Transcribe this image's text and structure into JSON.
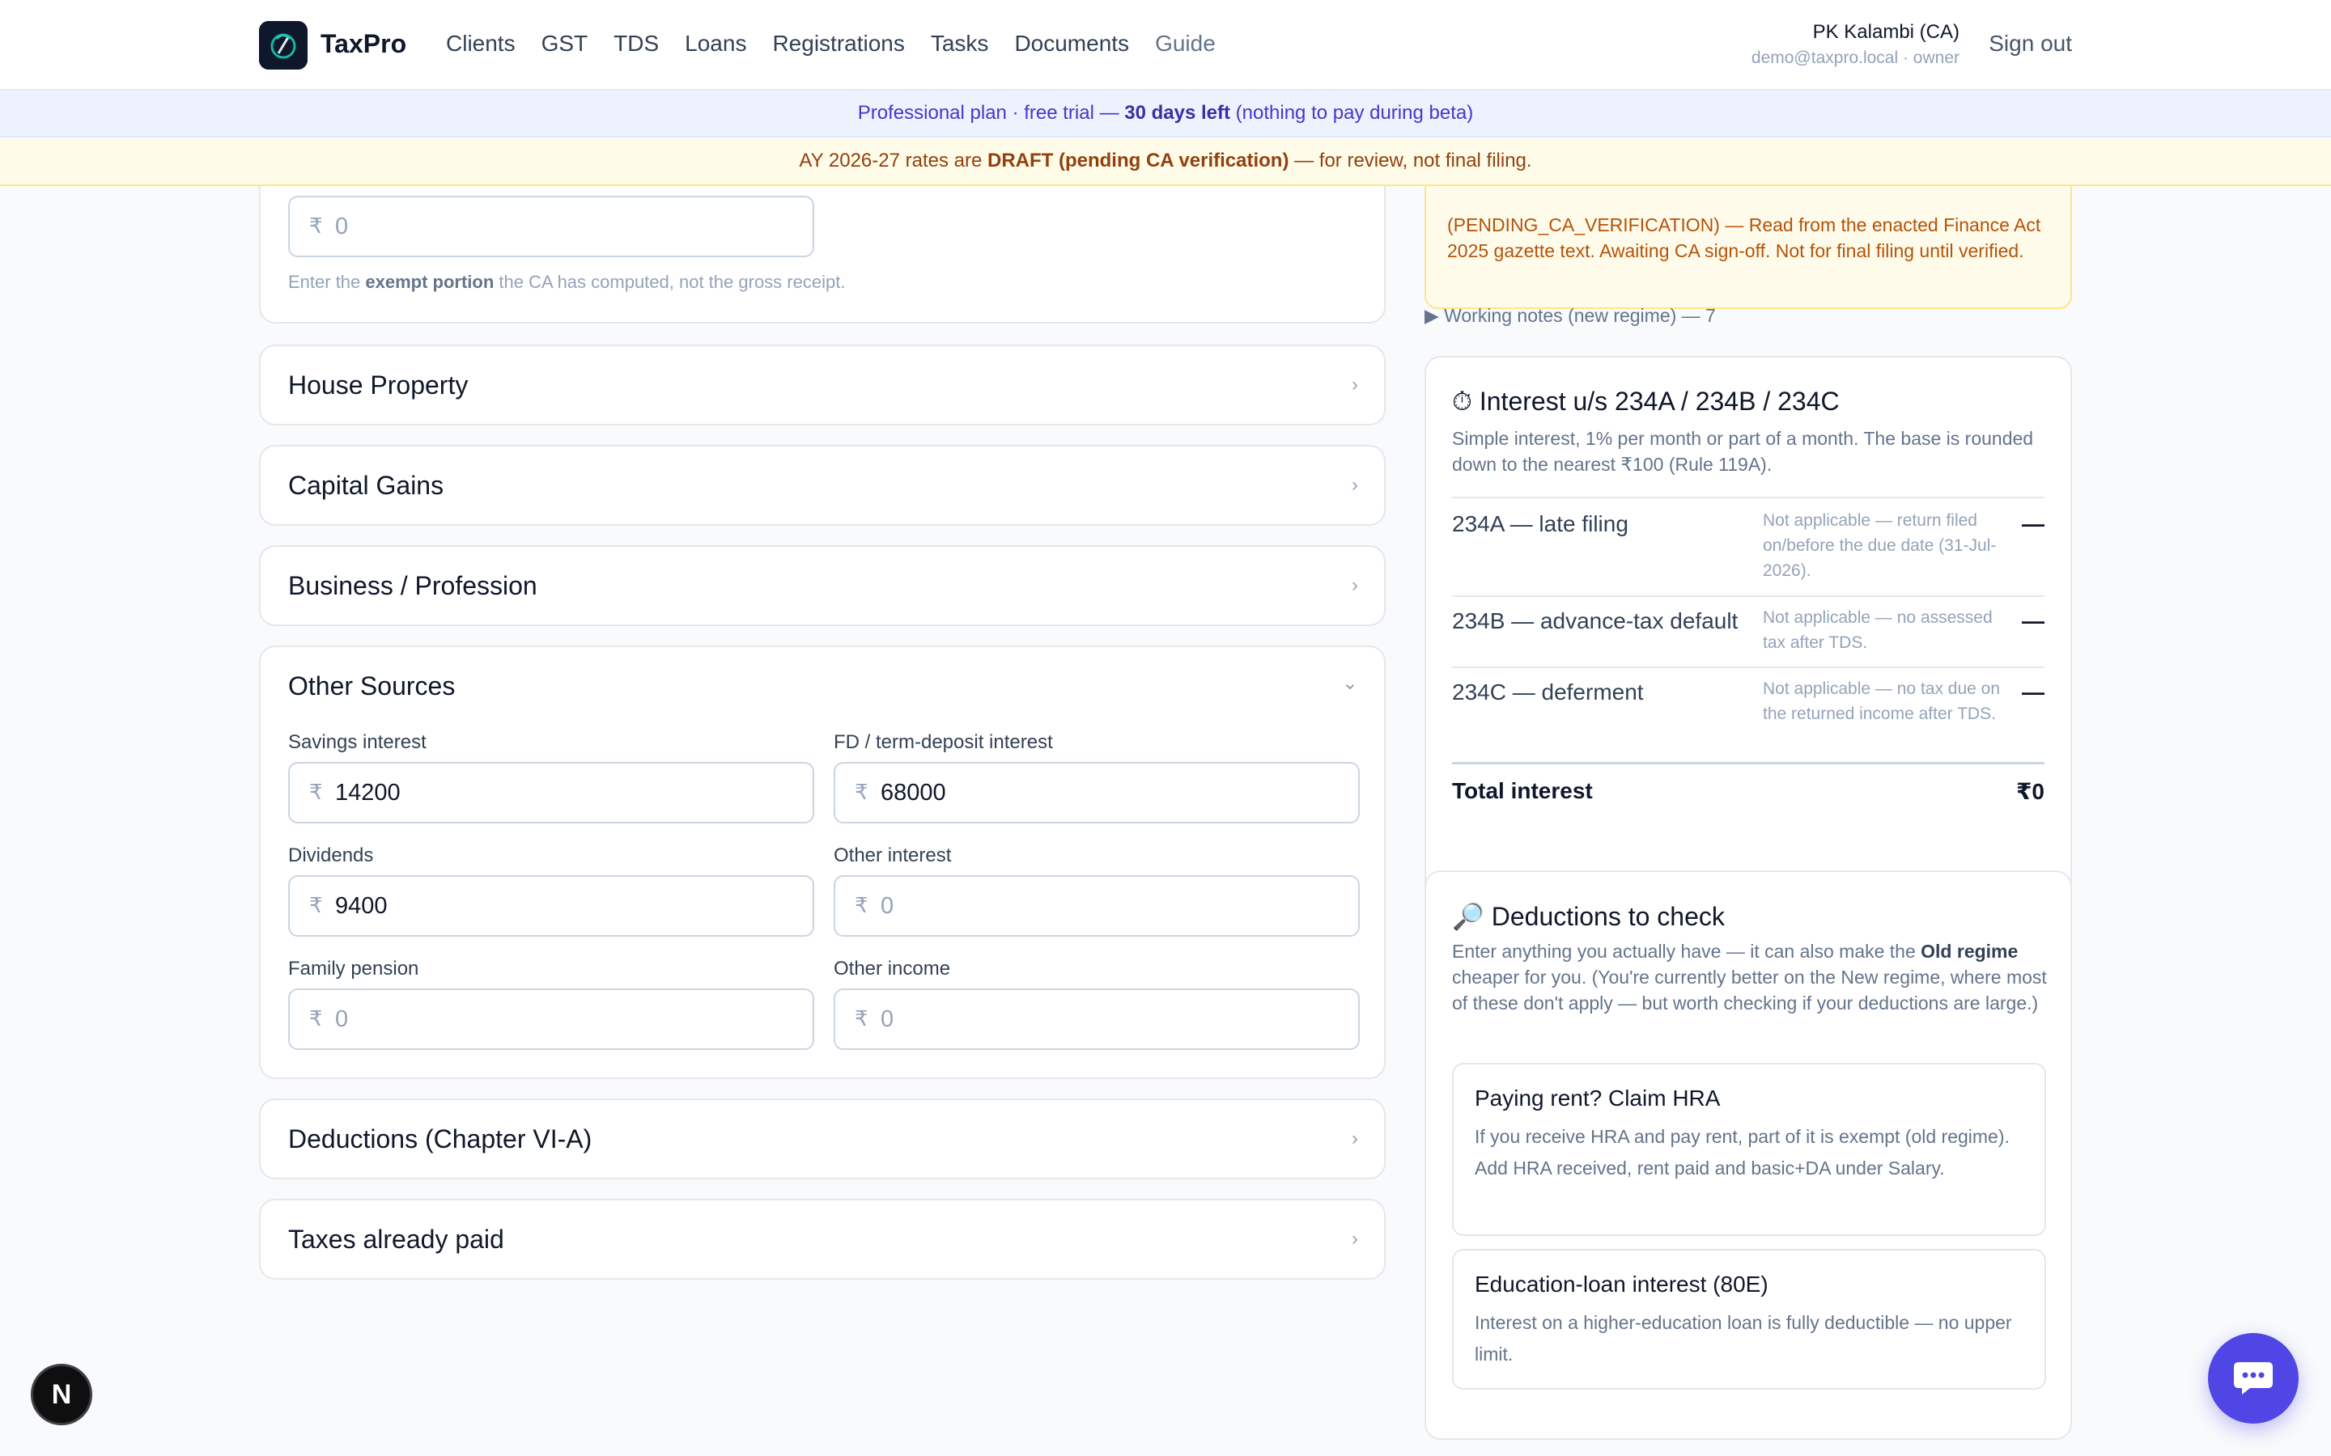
{
  "nav": {
    "brand": "TaxPro",
    "links": [
      "Clients",
      "GST",
      "TDS",
      "Loans",
      "Registrations",
      "Tasks",
      "Documents",
      "Guide"
    ],
    "user_name": "PK Kalambi (CA)",
    "user_email": "demo@taxpro.local · owner",
    "signout": "Sign out"
  },
  "banner_plan": {
    "prefix": "Professional plan · free trial — ",
    "highlight": "30 days left",
    "suffix": " (nothing to pay during beta)"
  },
  "banner_draft": {
    "prefix": "AY 2026-27 rates are ",
    "highlight": "DRAFT (pending CA verification)",
    "suffix": " — for review, not final filing."
  },
  "exempt_field": {
    "value": "0",
    "hint_prefix": "Enter the ",
    "hint_bold": "exempt portion",
    "hint_suffix": " the CA has computed, not the gross receipt."
  },
  "sections": {
    "house_property": "House Property",
    "capital_gains": "Capital Gains",
    "business": "Business / Profession",
    "other_sources": "Other Sources",
    "deductions": "Deductions (Chapter VI-A)",
    "taxes_paid": "Taxes already paid"
  },
  "other_sources": {
    "savings_label": "Savings interest",
    "savings_value": "14200",
    "fd_label": "FD / term-deposit interest",
    "fd_value": "68000",
    "dividends_label": "Dividends",
    "dividends_value": "9400",
    "other_interest_label": "Other interest",
    "other_interest_value": "0",
    "family_pension_label": "Family pension",
    "family_pension_value": "0",
    "other_income_label": "Other income",
    "other_income_value": "0"
  },
  "currency_symbol": "₹",
  "notice": {
    "text": "(PENDING_CA_VERIFICATION) — Read from the enacted Finance Act 2025 gazette text. Awaiting CA sign-off. Not for final filing until verified."
  },
  "working_notes": "Working notes (new regime) — 7",
  "interest": {
    "icon": "⏱",
    "title": "Interest u/s 234A / 234B / 234C",
    "subtitle": "Simple interest, 1% per month or part of a month. The base is rounded down to the nearest ₹100 (Rule 119A).",
    "rows": [
      {
        "name": "234A — late filing",
        "note": "Not applicable — return filed on/before the due date (31-Jul-2026).",
        "value": "—"
      },
      {
        "name": "234B — advance-tax default",
        "note": "Not applicable — no assessed tax after TDS.",
        "value": "—"
      },
      {
        "name": "234C — deferment",
        "note": "Not applicable — no tax due on the returned income after TDS.",
        "value": "—"
      }
    ],
    "total_label": "Total interest",
    "total_value": "₹0"
  },
  "deductions_check": {
    "icon": "🔎",
    "title": "Deductions to check",
    "sub_prefix": "Enter anything you actually have — it can also make the ",
    "sub_bold": "Old regime",
    "sub_suffix": " cheaper for you. (You're currently better on the New regime, where most of these don't apply — but worth checking if your deductions are large.)",
    "items": [
      {
        "title": "Paying rent? Claim HRA",
        "body": "If you receive HRA and pay rent, part of it is exempt (old regime). Add HRA received, rent paid and basic+DA under Salary."
      },
      {
        "title": "Education-loan interest (80E)",
        "body": "Interest on a higher-education loan is fully deductible — no upper limit."
      }
    ]
  },
  "fab_next": "N",
  "colors": {
    "accent": "#4f46e5",
    "draft_banner": "#fefce8",
    "plan_banner": "#eef2ff"
  }
}
